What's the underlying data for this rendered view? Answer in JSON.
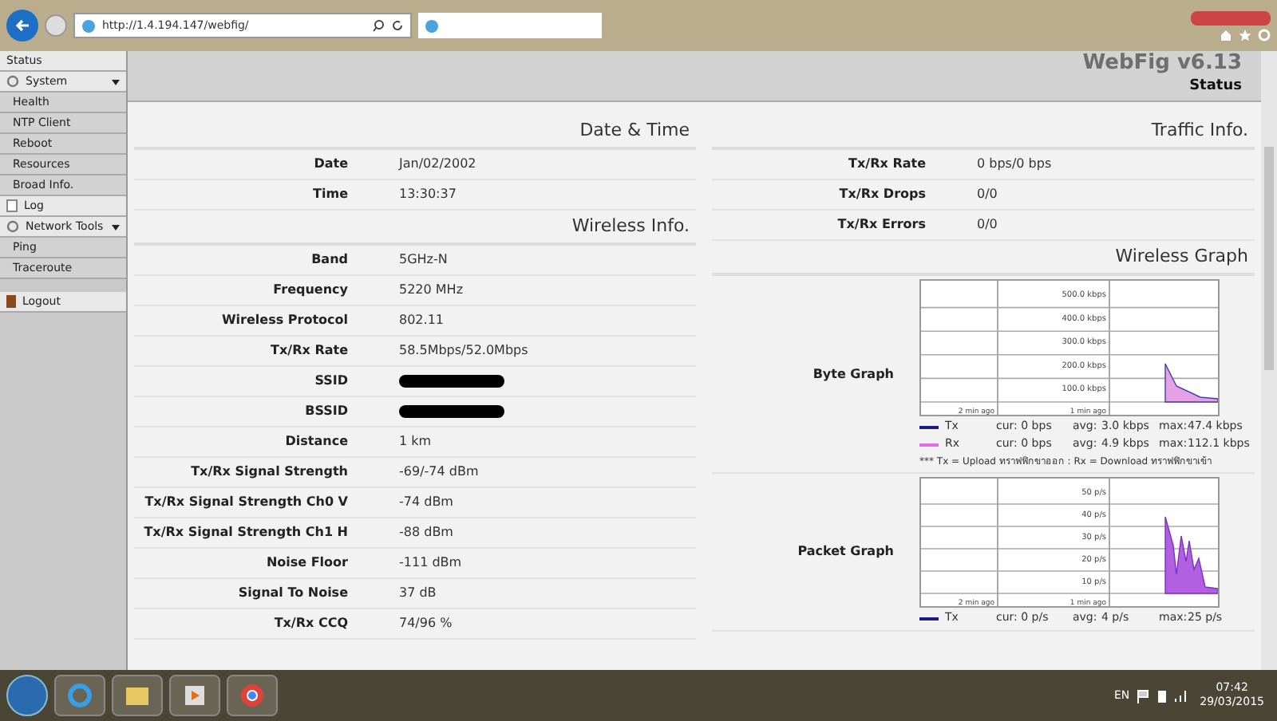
{
  "browser": {
    "url": "http://1.4.194.147/webfig/"
  },
  "header": {
    "brand": "WebFig v6.13",
    "page": "Status"
  },
  "sidebar": {
    "items": [
      {
        "label": "Status",
        "kind": "plain"
      },
      {
        "label": "System",
        "kind": "group",
        "expanded": true,
        "children": [
          {
            "label": "Health"
          },
          {
            "label": "NTP Client"
          },
          {
            "label": "Reboot"
          },
          {
            "label": "Resources"
          },
          {
            "label": "Broad Info."
          }
        ]
      },
      {
        "label": "Log",
        "kind": "page"
      },
      {
        "label": "Network Tools",
        "kind": "group",
        "expanded": true,
        "children": [
          {
            "label": "Ping"
          },
          {
            "label": "Traceroute"
          }
        ]
      },
      {
        "label": "Logout",
        "kind": "logout"
      }
    ]
  },
  "left_sections": [
    {
      "title": "Date & Time",
      "rows": [
        {
          "label": "Date",
          "value": "Jan/02/2002"
        },
        {
          "label": "Time",
          "value": "13:30:37"
        }
      ]
    },
    {
      "title": "Wireless Info.",
      "rows": [
        {
          "label": "Band",
          "value": "5GHz-N"
        },
        {
          "label": "Frequency",
          "value": "5220 MHz"
        },
        {
          "label": "Wireless Protocol",
          "value": "802.11"
        },
        {
          "label": "Tx/Rx Rate",
          "value": "58.5Mbps/52.0Mbps"
        },
        {
          "label": "SSID",
          "redacted": true
        },
        {
          "label": "BSSID",
          "redacted": true
        },
        {
          "label": "Distance",
          "value": "1 km"
        },
        {
          "label": "Tx/Rx Signal Strength",
          "value": "-69/-74 dBm"
        },
        {
          "label": "Tx/Rx Signal Strength Ch0 V",
          "value": "-74 dBm"
        },
        {
          "label": "Tx/Rx Signal Strength Ch1 H",
          "value": "-88 dBm"
        },
        {
          "label": "Noise Floor",
          "value": "-111 dBm"
        },
        {
          "label": "Signal To Noise",
          "value": "37 dB"
        },
        {
          "label": "Tx/Rx CCQ",
          "value": "74/96 %"
        }
      ]
    }
  ],
  "traffic": {
    "title": "Traffic Info.",
    "rows": [
      {
        "label": "Tx/Rx Rate",
        "value": "0 bps/0 bps"
      },
      {
        "label": "Tx/Rx Drops",
        "value": "0/0"
      },
      {
        "label": "Tx/Rx Errors",
        "value": "0/0"
      }
    ]
  },
  "wireless_graph": {
    "title": "Wireless Graph",
    "graphs": [
      {
        "label": "Byte Graph",
        "kind": "byte",
        "yticks": [
          "500.0 kbps",
          "400.0 kbps",
          "300.0 kbps",
          "200.0 kbps",
          "100.0 kbps"
        ],
        "xlabels": [
          "2 min ago",
          "1 min ago"
        ],
        "legend": [
          {
            "name": "Tx",
            "color": "#1c1c80",
            "cur": "cur: 0 bps",
            "avg_label": "avg:",
            "avg": "3.0 kbps",
            "max_label": "max:",
            "max": "47.4 kbps"
          },
          {
            "name": "Rx",
            "color": "#e070e0",
            "cur": "cur: 0 bps",
            "avg_label": "avg:",
            "avg": "4.9 kbps",
            "max_label": "max:",
            "max": "112.1 kbps"
          }
        ],
        "note": "*** Tx = Upload ทราฟฟิกขาออก : Rx = Download ทราฟฟิกขาเข้า"
      },
      {
        "label": "Packet Graph",
        "kind": "packet",
        "yticks": [
          "50 p/s",
          "40 p/s",
          "30 p/s",
          "20 p/s",
          "10 p/s"
        ],
        "xlabels": [
          "2 min ago",
          "1 min ago"
        ],
        "legend": [
          {
            "name": "Tx",
            "color": "#1c1c80",
            "cur": "cur: 0 p/s",
            "avg_label": "avg:",
            "avg": "4 p/s",
            "max_label": "max:",
            "max": "25 p/s"
          }
        ]
      }
    ]
  },
  "taskbar": {
    "language": "EN",
    "time": "07:42",
    "date": "29/03/2015"
  }
}
